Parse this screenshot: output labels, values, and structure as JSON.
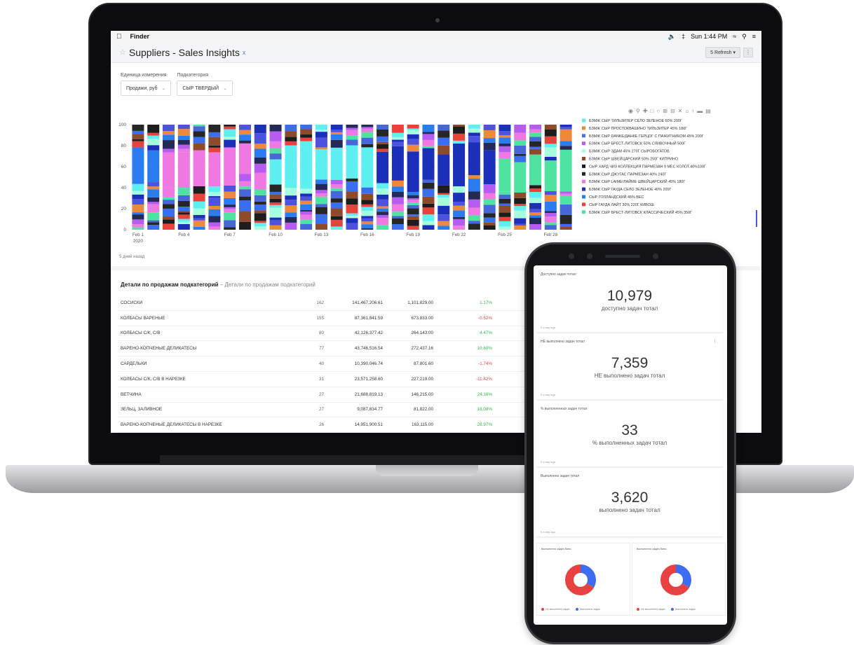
{
  "menubar": {
    "apple": "",
    "app": "Finder",
    "clock": "Sun 1:44 PM"
  },
  "titlebar": {
    "title": "Suppliers - Sales Insights",
    "tag": "x",
    "refresh": "5 Refresh"
  },
  "filters": [
    {
      "label": "Единица измерения",
      "value": "Продажи, руб"
    },
    {
      "label": "Подкатегория",
      "value": "СЫР ТВЕРДЫЙ"
    }
  ],
  "chart_data": {
    "type": "bar",
    "stacked": true,
    "ylim": [
      0,
      100
    ],
    "yticks": [
      0,
      20,
      40,
      60,
      80,
      100
    ],
    "xticks": [
      {
        "label": "Feb 1",
        "sub": "2020",
        "at": 0
      },
      {
        "label": "Feb 4",
        "at": 3
      },
      {
        "label": "Feb 7",
        "at": 6
      },
      {
        "label": "Feb 10",
        "at": 9
      },
      {
        "label": "Feb 13",
        "at": 12
      },
      {
        "label": "Feb 16",
        "at": 15
      },
      {
        "label": "Feb 19",
        "at": 18
      },
      {
        "label": "Feb 22",
        "at": 21
      },
      {
        "label": "Feb 25",
        "at": 24
      },
      {
        "label": "Feb 28",
        "at": 27
      }
    ],
    "bar_count": 29,
    "colors": [
      "#4fe3a1",
      "#3a6ef0",
      "#e8433a",
      "#1c2fb8",
      "#2a7cf0",
      "#ef78e2",
      "#262626",
      "#1d1d1d",
      "#a6ffdc",
      "#f0883a",
      "#b75cf0",
      "#4766d8",
      "#8e4b2c",
      "#5ef0f0",
      "#4d53df",
      "#222a55"
    ],
    "legend": [
      {
        "label": "БЗМЖ СЫР ТИЛЬЗИТЕР СЕЛО ЗЕЛЕНОЕ 50% 200Г",
        "color": "#5ef0f0"
      },
      {
        "label": "БЗМЖ СЫР ПРОСТОКВАШИНО ТИЛЬЗИТЕР 45% 180Г",
        "color": "#f0883a"
      },
      {
        "label": "БЗМЖ СЫР DANKE/ДАНКЕ ГЕРЦОГ С ПАЖИТНИКОМ 45% 200Г",
        "color": "#4d6fe0"
      },
      {
        "label": "БЗМЖ СЫР БРЕСТ-ЛИТОВСК 50% СЛИВОЧНЫЙ 500Г",
        "color": "#b75cf0"
      },
      {
        "label": "БЗМЖ СЫР ЭДАМ 45% 270Г СЫРОБОГАТОВ",
        "color": "#a6ffdc"
      },
      {
        "label": "БЗМЖ СЫР ШВЕЙЦАРСКИЙ 50% 250Г КИПРИНО",
        "color": "#8e4b2c"
      },
      {
        "label": "СЫР ХАРД ЧИЗ КОЛЛЕКЦИЯ ПАРМЕЗАН 9 МЕС КОЛОТ.40%100Г",
        "color": "#1d1d1d"
      },
      {
        "label": "БЗМЖ СЫР ДЖУГАС ПАРМЕЗАН 40% 240Г",
        "color": "#262626"
      },
      {
        "label": "БЗМЖ СЫР LAIME/ЛАЙМЕ ШВЕЙЦАРСКИЙ 45% 180Г",
        "color": "#ef78e2"
      },
      {
        "label": "БЗМЖ СЫР ГАУДА СЕЛО ЗЕЛЕНОЕ 40% 200Г",
        "color": "#1c2fb8"
      },
      {
        "label": "СЫР ГОЛЛАНДСКИЙ 45% ВЕС",
        "color": "#2a7cf0"
      },
      {
        "label": "СЫР ГАУДА ЛАЙТ 30% 220Г КИВОШ",
        "color": "#e8433a"
      },
      {
        "label": "БЗМЖ СЫР БРЕСТ-ЛИТОВСК КЛАССИЧЕСКИЙ 45% 350Г",
        "color": "#4fe3a1"
      }
    ]
  },
  "generated": "5 дней назад",
  "details": {
    "title": "Детали по продажам подкатегорий",
    "subtitle": "Детали по продажам подкатегорий",
    "rows": [
      {
        "name": "СОСИСКИ",
        "count": "162",
        "sum": "141,467,206.61",
        "base": "1,101,829.00",
        "pct": "1.17%",
        "sign": "pos"
      },
      {
        "name": "КОЛБАСЫ ВАРЕНЫЕ",
        "count": "155",
        "sum": "87,361,841.59",
        "base": "673,833.00",
        "pct": "-0.52%",
        "sign": "neg"
      },
      {
        "name": "КОЛБАСЫ С/К, С/В",
        "count": "80",
        "sum": "42,126,377.42",
        "base": "264,143.00",
        "pct": "4.47%",
        "sign": "pos"
      },
      {
        "name": "ВАРЕНО-КОПЧЕНЫЕ ДЕЛИКАТЕСЫ",
        "count": "77",
        "sum": "43,746,516.54",
        "base": "272,437.16",
        "pct": "10.60%",
        "sign": "pos"
      },
      {
        "name": "САРДЕЛЬКИ",
        "count": "40",
        "sum": "10,390,046.74",
        "base": "87,801.60",
        "pct": "-1.74%",
        "sign": "neg"
      },
      {
        "name": "КОЛБАСЫ С/К, С/В В НАРЕЗКЕ",
        "count": "31",
        "sum": "23,571,258.60",
        "base": "227,219.00",
        "pct": "-11.42%",
        "sign": "neg"
      },
      {
        "name": "ВЕТЧИНА",
        "count": "27",
        "sum": "21,688,819.13",
        "base": "146,215.00",
        "pct": "24.16%",
        "sign": "pos"
      },
      {
        "name": "ЗЕЛЬЦ, ЗАЛИВНОЕ",
        "count": "27",
        "sum": "9,087,834.77",
        "base": "81,822.00",
        "pct": "18.08%",
        "sign": "pos"
      },
      {
        "name": "ВАРЕНО-КОПЧЕНЫЕ ДЕЛИКАТЕСЫ В НАРЕЗКЕ",
        "count": "26",
        "sum": "14,951,900.51",
        "base": "163,115.00",
        "pct": "28.97%",
        "sign": "pos"
      }
    ]
  },
  "phone": {
    "kpis": [
      {
        "head": "Доступно задач тотал",
        "num": "10,979",
        "cap": "доступно задач тотал",
        "foot": "5 a day ago"
      },
      {
        "head": "НЕ выполнено задач тотал",
        "num": "7,359",
        "cap": "НЕ выполнено задач тотал",
        "foot": "5 a day ago"
      },
      {
        "head": "% выполненных задач тотал",
        "num": "33",
        "cap": "% выполненных задач тотал",
        "foot": "5 a day ago"
      },
      {
        "head": "Выполнено задач тотал",
        "num": "3,620",
        "cap": "выполнено задач тотал",
        "foot": "5 a day ago"
      }
    ],
    "donuts": [
      {
        "head": "Выполнено задач банк",
        "legend": [
          "Не выполнено задач",
          "Выполнено задач"
        ]
      },
      {
        "head": "Выполнено задач банк",
        "legend": [
          "Не выполнено задач",
          "Выполнено задач"
        ]
      }
    ],
    "colors": {
      "done": "#3d6cf0",
      "undone": "#e84141"
    }
  }
}
